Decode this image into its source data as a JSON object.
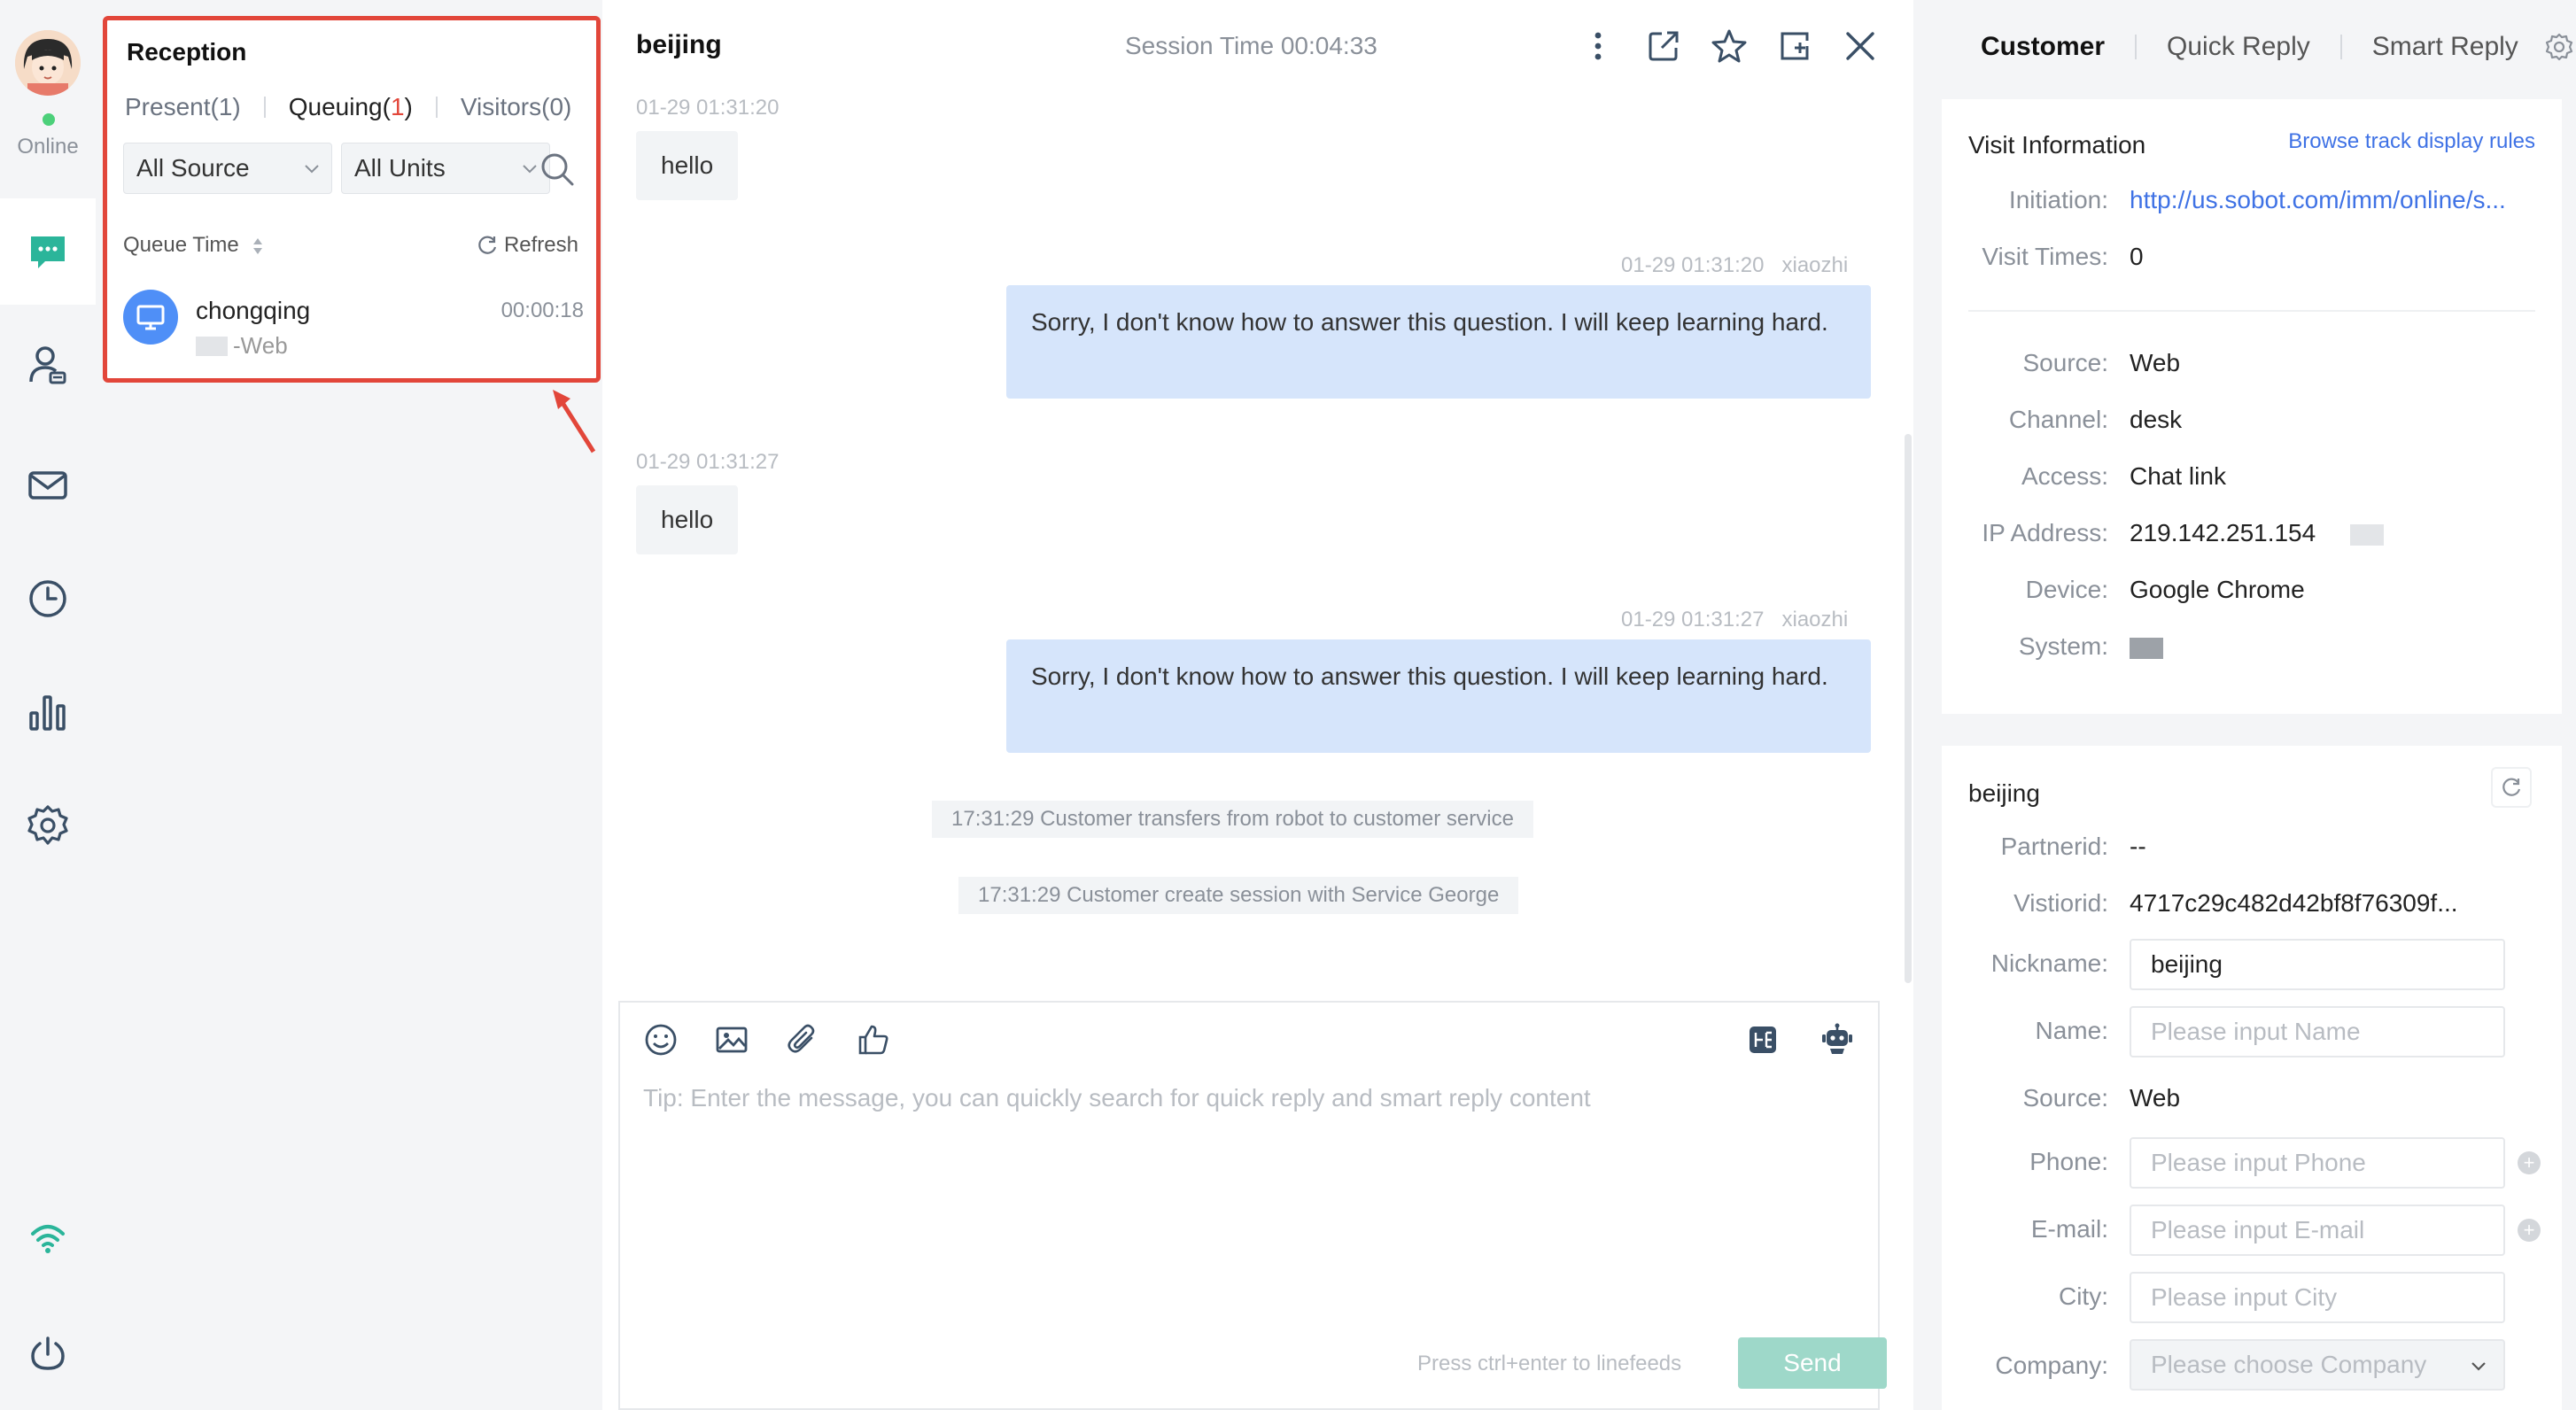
{
  "nav": {
    "status_label": "Online",
    "status_color": "#4cd07a",
    "items": [
      {
        "name": "chat-icon"
      },
      {
        "name": "customer-icon"
      },
      {
        "name": "mail-icon"
      },
      {
        "name": "history-icon"
      },
      {
        "name": "stats-icon"
      },
      {
        "name": "settings-icon"
      }
    ],
    "bottom": [
      {
        "name": "wifi-icon"
      },
      {
        "name": "power-icon"
      }
    ]
  },
  "queue": {
    "title": "Reception",
    "tabs": [
      {
        "label": "Present",
        "count": "(1)"
      },
      {
        "label": "Queuing",
        "count_open": "(",
        "count": "1",
        "count_close": ")"
      },
      {
        "label": "Visitors",
        "count": "(0)"
      }
    ],
    "source_select": "All Source",
    "units_select": "All Units",
    "sort_label": "Queue Time",
    "refresh_label": "Refresh",
    "visitors": [
      {
        "name": "chongqing",
        "wait": "00:00:18",
        "source": "-Web"
      }
    ]
  },
  "chat": {
    "title": "beijing",
    "session_time": "Session Time 00:04:33",
    "messages": [
      {
        "side": "left",
        "time": "01-29 01:31:20",
        "text": "hello"
      },
      {
        "side": "right",
        "time": "01-29 01:31:20",
        "agent": "xiaozhi",
        "text": "Sorry, I don't know how to answer this question. I will keep learning hard."
      },
      {
        "side": "left",
        "time": "01-29 01:31:27",
        "text": "hello"
      },
      {
        "side": "right",
        "time": "01-29 01:31:27",
        "agent": "xiaozhi",
        "text": "Sorry, I don't know how to answer this question. I will keep learning hard."
      }
    ],
    "system_messages": [
      "17:31:29 Customer transfers from robot to customer service",
      "17:31:29 Customer create session with Service George"
    ],
    "composer": {
      "placeholder": "Tip: Enter the message, you can quickly search for quick reply and smart reply content",
      "hint": "Press ctrl+enter to linefeeds",
      "send_label": "Send"
    }
  },
  "right": {
    "tabs": [
      "Customer",
      "Quick Reply",
      "Smart Reply"
    ],
    "visit": {
      "title": "Visit Information",
      "link": "Browse track display rules",
      "initiation_label": "Initiation",
      "initiation_value": "http://us.sobot.com/imm/online/s...",
      "visit_times_label": "Visit Times",
      "visit_times_value": "0",
      "source_label": "Source",
      "source_value": "Web",
      "channel_label": "Channel",
      "channel_value": "desk",
      "access_label": "Access",
      "access_value": "Chat link",
      "ip_label": "IP Address",
      "ip_value": "219.142.251.154",
      "device_label": "Device",
      "device_value": "Google Chrome",
      "system_label": "System"
    },
    "customer": {
      "title": "beijing",
      "partnerid_label": "Partnerid",
      "partnerid_value": "--",
      "visitorid_label": "Vistiorid",
      "visitorid_value": "4717c29c482d42bf8f76309f...",
      "nickname_label": "Nickname",
      "nickname_value": "beijing",
      "name_label": "Name",
      "name_placeholder": "Please input Name",
      "source_label": "Source",
      "source_value": "Web",
      "phone_label": "Phone",
      "phone_placeholder": "Please input Phone",
      "email_label": "E-mail",
      "email_placeholder": "Please input E-mail",
      "city_label": "City",
      "city_placeholder": "Please input City",
      "company_label": "Company",
      "company_placeholder": "Please choose Company"
    }
  },
  "colors": {
    "accent": "#3f72e5",
    "highlight_border": "#e2463a",
    "bubble_right": "#d6e5fb",
    "send": "#9ed8c9",
    "nav_icon": "#3a4f66",
    "chat_icon_active": "#2bb59a"
  }
}
